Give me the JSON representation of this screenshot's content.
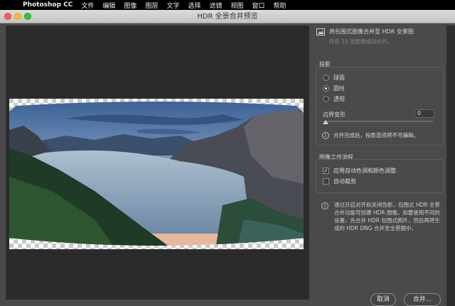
{
  "menubar": {
    "app_name": "Photoshop CC",
    "items": [
      "文件",
      "编辑",
      "图像",
      "图层",
      "文字",
      "选择",
      "滤镜",
      "视图",
      "窗口",
      "帮助"
    ]
  },
  "window": {
    "title": "HDR 全景合并预览"
  },
  "header": {
    "main_text": "将包围式图像合并至 HDR 全景图",
    "sub_text": "所有 15 张图像成功合并。"
  },
  "projection": {
    "label": "投影",
    "options": [
      {
        "label": "球面",
        "selected": false
      },
      {
        "label": "圆柱",
        "selected": true
      },
      {
        "label": "透视",
        "selected": false
      }
    ],
    "boundary_label": "边界变形",
    "boundary_value": "0",
    "note": "合并完成后，投影选项将不可编辑。"
  },
  "workflow": {
    "label": "图像工作流程",
    "auto_tone": {
      "label": "应用自动色调和颜色调整",
      "checked": true
    },
    "auto_crop": {
      "label": "自动裁剪",
      "checked": false
    }
  },
  "description": "通过开启对齐和关闭伪影，包围式 HDR 全景合并功能可创建 HDR 图像。如要使用不同的设置，先合并 HDR 包围式照片，然后再将生成的 HDR DNG 合并至全景图中。",
  "buttons": {
    "cancel": "取消",
    "merge": "合并..."
  },
  "icons": {
    "apple": "apple-logo-icon",
    "info": "info-icon",
    "image": "image-icon"
  }
}
